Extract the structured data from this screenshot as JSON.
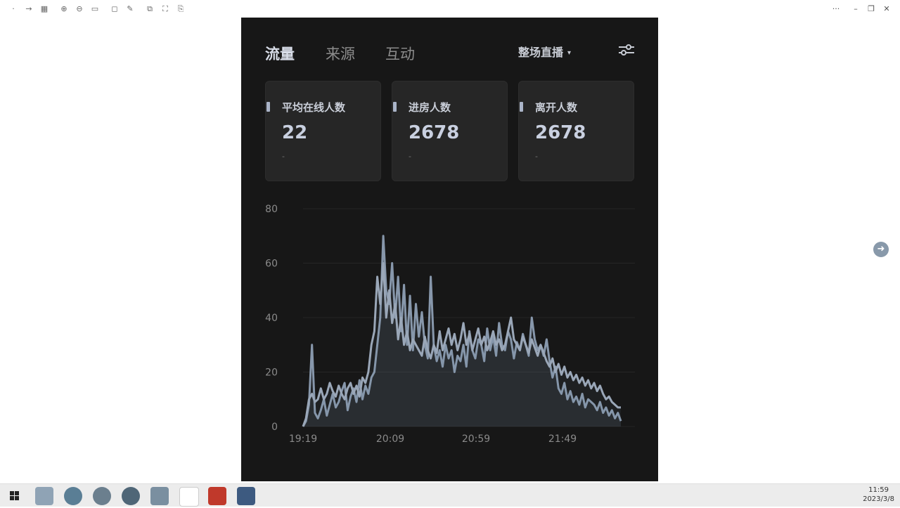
{
  "tabs": [
    {
      "label": "流量",
      "active": true
    },
    {
      "label": "来源",
      "active": false
    },
    {
      "label": "互动",
      "active": false
    }
  ],
  "scope": {
    "label": "整场直播",
    "caret": "▾"
  },
  "cards": [
    {
      "label": "平均在线人数",
      "value": "22",
      "sub": "-"
    },
    {
      "label": "进房人数",
      "value": "2678",
      "sub": "-"
    },
    {
      "label": "离开人数",
      "value": "2678",
      "sub": "-"
    }
  ],
  "taskbar": {
    "time": "11:59",
    "date": "2023/3/8"
  },
  "chart_data": {
    "type": "line",
    "ylim": [
      0,
      80
    ],
    "yticks": [
      "0",
      "20",
      "40",
      "60",
      "80"
    ],
    "xticks": [
      "19:19",
      "20:09",
      "20:59",
      "21:49"
    ],
    "series": [
      {
        "values": [
          0,
          2,
          8,
          30,
          5,
          3,
          6,
          10,
          4,
          8,
          12,
          7,
          9,
          13,
          16,
          6,
          11,
          14,
          9,
          17,
          10,
          15,
          12,
          18,
          20,
          30,
          40,
          70,
          50,
          45,
          60,
          40,
          55,
          35,
          52,
          30,
          48,
          28,
          45,
          33,
          42,
          30,
          25,
          55,
          30,
          24,
          28,
          22,
          30,
          25,
          28,
          20,
          26,
          24,
          30,
          22,
          35,
          28,
          25,
          32,
          30,
          24,
          36,
          28,
          33,
          26,
          38,
          30,
          28,
          35,
          32,
          25,
          31,
          28,
          34,
          30,
          26,
          40,
          32,
          28,
          30,
          26,
          32,
          24,
          18,
          22,
          14,
          12,
          16,
          10,
          13,
          9,
          11,
          8,
          12,
          7,
          10,
          9,
          8,
          6,
          9,
          5,
          7,
          4,
          6,
          3,
          5,
          2
        ]
      },
      {
        "values": [
          0,
          3,
          10,
          12,
          9,
          10,
          14,
          10,
          12,
          16,
          13,
          11,
          15,
          12,
          10,
          14,
          16,
          12,
          15,
          11,
          18,
          16,
          20,
          30,
          35,
          55,
          45,
          60,
          40,
          50,
          38,
          45,
          32,
          40,
          30,
          35,
          28,
          32,
          30,
          28,
          26,
          33,
          28,
          25,
          30,
          27,
          35,
          28,
          32,
          36,
          30,
          34,
          28,
          32,
          38,
          30,
          34,
          28,
          32,
          36,
          30,
          33,
          28,
          31,
          35,
          30,
          32,
          28,
          30,
          35,
          40,
          32,
          30,
          28,
          33,
          30,
          27,
          32,
          29,
          26,
          30,
          27,
          24,
          22,
          25,
          20,
          23,
          19,
          22,
          18,
          20,
          17,
          19,
          16,
          18,
          15,
          17,
          14,
          16,
          13,
          15,
          12,
          10,
          11,
          9,
          8,
          7,
          7
        ]
      }
    ]
  }
}
